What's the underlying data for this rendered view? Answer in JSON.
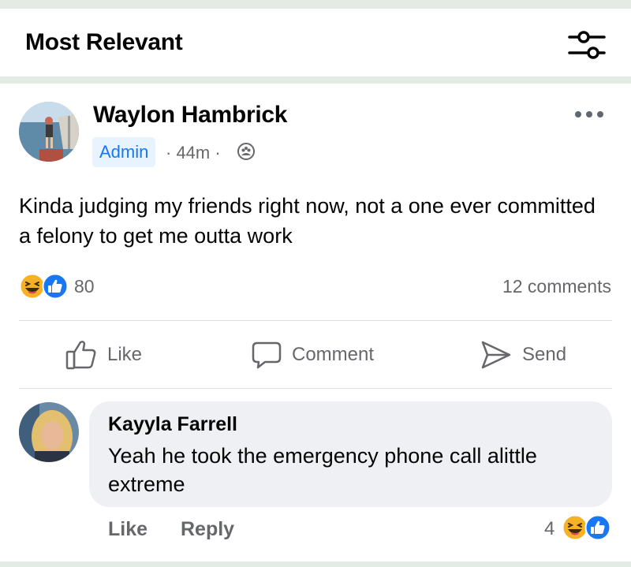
{
  "header": {
    "title": "Most Relevant",
    "filter_icon": "sliders-icon"
  },
  "post": {
    "author": "Waylon Hambrick",
    "badge": "Admin",
    "time": "· 44m ·",
    "audience_icon": "group-icon",
    "text": "Kinda judging my friends right now, not a one ever committed a felony to get me outta work",
    "reactions": {
      "icons": [
        "haha",
        "like"
      ],
      "count": "80"
    },
    "comments_count": "12 comments",
    "actions": {
      "like": "Like",
      "comment": "Comment",
      "send": "Send"
    }
  },
  "comment": {
    "author": "Kayyla Farrell",
    "text": "Yeah he took the emergency phone call alittle extreme",
    "like_label": "Like",
    "reply_label": "Reply",
    "reaction_count": "4",
    "reaction_icons": [
      "haha",
      "like"
    ]
  },
  "colors": {
    "accent": "#1877f2",
    "badge_bg": "#e7f3ff",
    "muted_text": "#65676b",
    "bubble": "#eef0f3",
    "haha": "#f7b125"
  }
}
